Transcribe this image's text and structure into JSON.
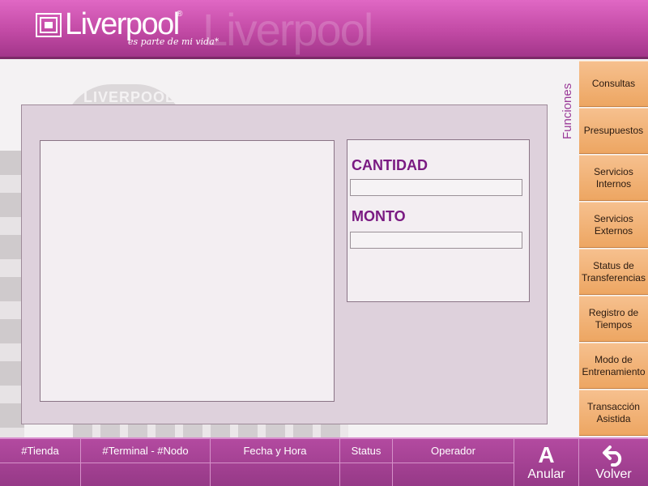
{
  "header": {
    "logo_text": "Liverpool",
    "logo_reg": "®",
    "tagline": "es parte de mi vida*"
  },
  "background": {
    "dome_text": "LIVERPOOL"
  },
  "panel": {
    "cantidad_label": "CANTIDAD",
    "cantidad_value": "",
    "monto_label": "MONTO",
    "monto_value": ""
  },
  "sidebar": {
    "title": "Funciones",
    "items": [
      {
        "label": "Consultas"
      },
      {
        "label": "Presupuestos"
      },
      {
        "label": "Servicios Internos"
      },
      {
        "label": "Servicios Externos"
      },
      {
        "label": "Status de Transferencias"
      },
      {
        "label": "Registro de Tiempos"
      },
      {
        "label": "Modo de Entrenamiento"
      },
      {
        "label": "Transacción Asistida"
      }
    ]
  },
  "footer": {
    "columns": [
      {
        "label": "#Tienda",
        "value": ""
      },
      {
        "label": "#Terminal - #Nodo",
        "value": ""
      },
      {
        "label": "Fecha y Hora",
        "value": ""
      },
      {
        "label": "Status",
        "value": ""
      },
      {
        "label": "Operador",
        "value": ""
      }
    ],
    "anular": {
      "glyph": "A",
      "label": "Anular"
    },
    "volver": {
      "label": "Volver"
    }
  },
  "colors": {
    "header_magenta": "#c24aa5",
    "accent_purple": "#7a1a82",
    "sidebar_orange": "#eda662",
    "panel_bg": "#ded1dc"
  },
  "icons": {
    "logo": "liverpool-logo-icon",
    "volver": "return-arrow-icon"
  }
}
